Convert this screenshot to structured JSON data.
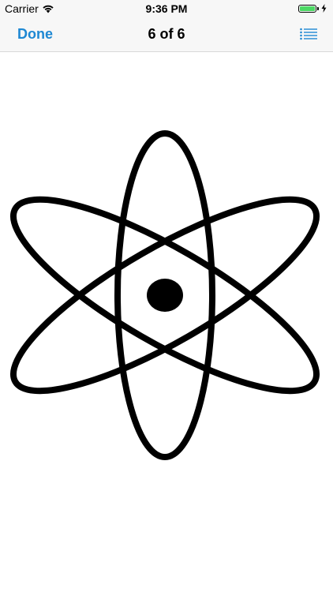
{
  "status_bar": {
    "carrier": "Carrier",
    "time": "9:36 PM",
    "battery_level": 1.0,
    "battery_color": "#4cd964",
    "icons": [
      "wifi-icon",
      "battery-icon",
      "charging-bolt-icon"
    ]
  },
  "nav": {
    "done_label": "Done",
    "title": "6 of 6",
    "list_icon": "list-icon",
    "accent_color": "#1e88d3"
  },
  "content": {
    "image": "atom-symbol"
  }
}
